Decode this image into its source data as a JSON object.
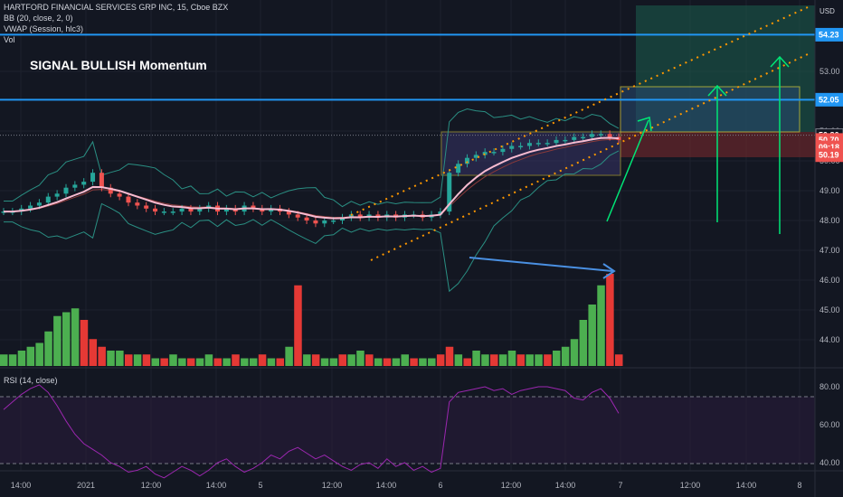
{
  "legend": {
    "title": "HARTFORD FINANCIAL SERVICES GRP INC, 15, Cboe BZX",
    "bb": "BB (20, close, 2, 0)",
    "vwap": "VWAP (Session, hlc3)",
    "vol": "Vol"
  },
  "annotation": "SIGNAL BULLISH Momentum",
  "rsi_label": "RSI (14, close)",
  "currency": "USD",
  "price_axis": {
    "ticks": [
      "53.00",
      "51.00",
      "50.00",
      "49.00",
      "48.00",
      "47.00",
      "46.00",
      "45.00",
      "44.00"
    ],
    "tick_values": [
      53,
      51,
      50,
      49,
      48,
      47,
      46,
      45,
      44
    ],
    "badges": [
      {
        "text": "54.23",
        "value": 54.23,
        "color": "#2196f3"
      },
      {
        "text": "52.05",
        "value": 52.05,
        "color": "#2196f3"
      },
      {
        "text": "50.86",
        "value": 50.86,
        "color": "#131722"
      },
      {
        "text": "50.70",
        "value": 50.7,
        "color": "#ef5350"
      },
      {
        "text": "09:18",
        "value": 50.45,
        "color": "#ef5350"
      },
      {
        "text": "50.19",
        "value": 50.19,
        "color": "#ef5350"
      }
    ]
  },
  "rsi_axis": {
    "ticks": [
      "80.00",
      "60.00",
      "40.00"
    ],
    "tick_values": [
      80,
      60,
      40
    ]
  },
  "time_axis": {
    "labels": [
      "14:00",
      "2021",
      "12:00",
      "14:00",
      "5",
      "12:00",
      "14:00",
      "6",
      "12:00",
      "14:00",
      "7",
      "12:00",
      "14:00",
      "8"
    ]
  },
  "colors": {
    "background": "#131722",
    "up": "#26a69a",
    "down": "#ef5350",
    "vol_up": "#4caf50",
    "vol_down": "#e53935",
    "bb": "#2a8f83",
    "vwap": "#f8bbd0",
    "hline": "#2196f3",
    "channel": "#ff9800",
    "box": "#ffeb3b",
    "arrow_green": "#00e676",
    "arrow_blue": "#4a90e2",
    "rsi": "#9c27b0"
  },
  "chart_data": {
    "type": "candlestick",
    "symbol": "HARTFORD FINANCIAL SERVICES GRP INC",
    "interval": "15",
    "exchange": "Cboe BZX",
    "price_range": [
      43.6,
      55.0
    ],
    "horizontal_levels": [
      54.23,
      52.05
    ],
    "last_price": 50.86,
    "close_points": [
      48.3,
      48.3,
      48.4,
      48.5,
      48.6,
      48.8,
      48.9,
      49.1,
      49.2,
      49.3,
      49.6,
      49.1,
      48.9,
      48.8,
      48.6,
      48.5,
      48.4,
      48.3,
      48.3,
      48.3,
      48.4,
      48.3,
      48.4,
      48.5,
      48.3,
      48.4,
      48.3,
      48.5,
      48.4,
      48.3,
      48.4,
      48.3,
      48.2,
      48.1,
      48.0,
      47.9,
      48.0,
      48.0,
      48.1,
      48.2,
      48.1,
      48.2,
      48.1,
      48.2,
      48.1,
      48.2,
      48.2,
      48.1,
      48.2,
      48.3,
      49.6,
      49.9,
      50.1,
      50.2,
      50.3,
      50.3,
      50.4,
      50.5,
      50.5,
      50.6,
      50.6,
      50.6,
      50.7,
      50.7,
      50.8,
      50.8,
      50.9,
      50.9,
      50.8,
      50.7
    ],
    "volume": [
      3,
      3,
      4,
      5,
      6,
      9,
      13,
      14,
      15,
      12,
      7,
      5,
      4,
      4,
      3,
      3,
      3,
      2,
      2,
      3,
      2,
      2,
      2,
      3,
      2,
      2,
      3,
      2,
      2,
      3,
      2,
      2,
      5,
      21,
      3,
      3,
      2,
      2,
      3,
      3,
      4,
      3,
      2,
      2,
      2,
      3,
      2,
      2,
      2,
      3,
      5,
      3,
      2,
      4,
      3,
      3,
      3,
      4,
      3,
      3,
      3,
      3,
      4,
      5,
      7,
      12,
      16,
      21,
      24,
      3
    ],
    "volume_colors": [
      "u",
      "u",
      "u",
      "u",
      "u",
      "u",
      "u",
      "u",
      "u",
      "d",
      "d",
      "d",
      "u",
      "u",
      "d",
      "u",
      "d",
      "u",
      "d",
      "u",
      "u",
      "d",
      "u",
      "u",
      "d",
      "u",
      "d",
      "u",
      "u",
      "d",
      "u",
      "d",
      "u",
      "d",
      "u",
      "d",
      "u",
      "u",
      "d",
      "u",
      "u",
      "d",
      "u",
      "d",
      "u",
      "u",
      "d",
      "u",
      "u",
      "d",
      "d",
      "u",
      "d",
      "u",
      "u",
      "d",
      "u",
      "u",
      "d",
      "u",
      "u",
      "d",
      "u",
      "u",
      "u",
      "u",
      "u",
      "u",
      "d",
      "d"
    ],
    "rsi": [
      68,
      72,
      76,
      79,
      81,
      77,
      70,
      62,
      55,
      50,
      47,
      44,
      40,
      38,
      35,
      36,
      38,
      34,
      32,
      35,
      38,
      36,
      33,
      36,
      40,
      42,
      38,
      35,
      37,
      40,
      44,
      42,
      46,
      48,
      45,
      42,
      44,
      41,
      38,
      36,
      39,
      40,
      37,
      42,
      38,
      40,
      36,
      38,
      35,
      37,
      72,
      77,
      78,
      79,
      80,
      78,
      79,
      76,
      78,
      79,
      80,
      80,
      79,
      78,
      74,
      73,
      77,
      79,
      74,
      66
    ],
    "rsi_range": [
      30,
      90
    ],
    "rsi_bands": [
      70,
      30
    ]
  }
}
